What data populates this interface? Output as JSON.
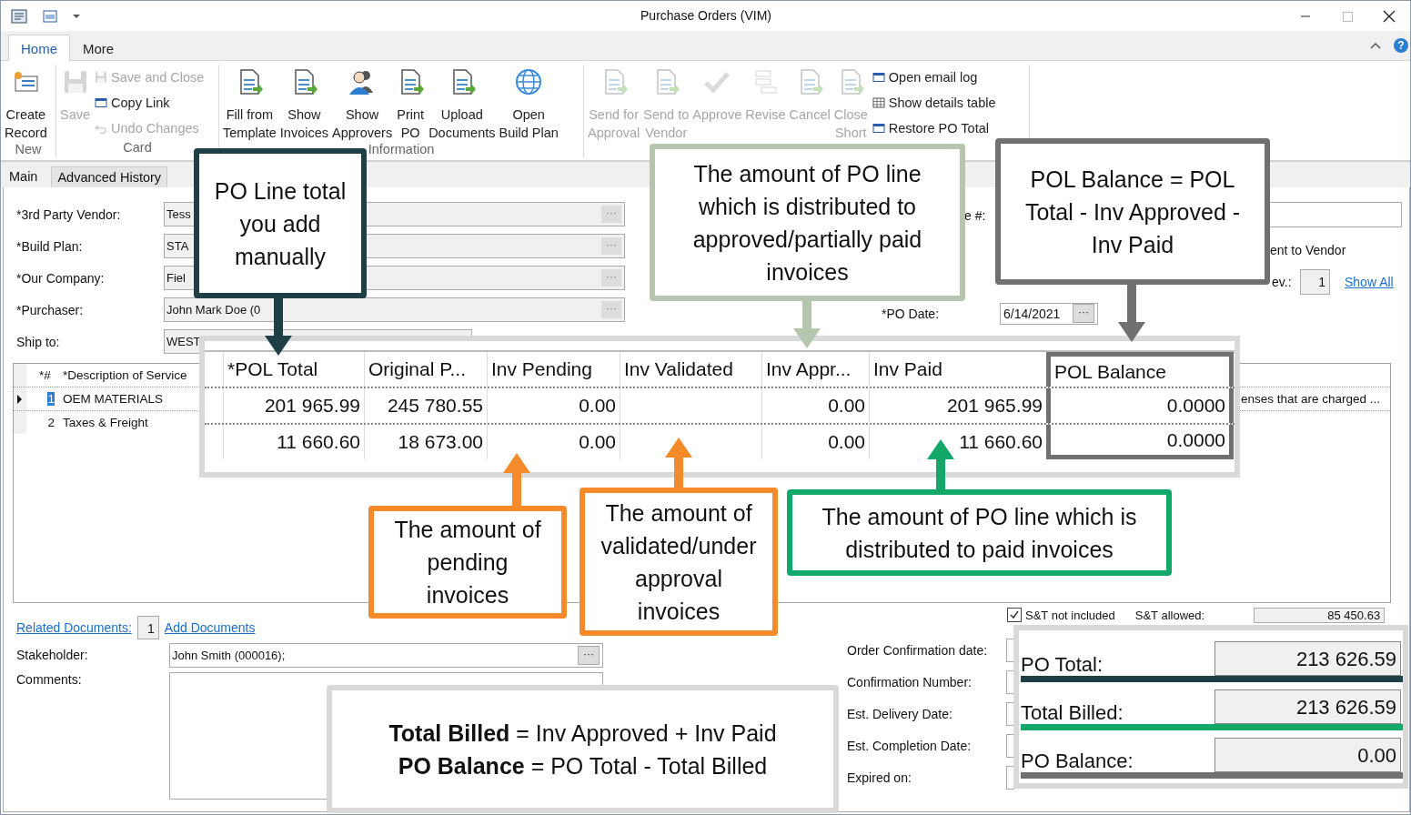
{
  "window": {
    "title": "Purchase Orders (VIM)",
    "help": "?"
  },
  "ribbon_tabs": [
    {
      "label": "Home",
      "selected": true
    },
    {
      "label": "More",
      "selected": false
    }
  ],
  "ribbon_groups": [
    {
      "label": "New",
      "buttons": [
        {
          "kind": "large",
          "lines": [
            "Create",
            "Record"
          ],
          "disabled": false
        }
      ]
    },
    {
      "label": "Card",
      "buttons": [
        {
          "kind": "large",
          "lines": [
            "Save"
          ],
          "disabled": true
        },
        {
          "kind": "small",
          "lines": [
            "Save and Close"
          ],
          "disabled": true
        },
        {
          "kind": "small",
          "lines": [
            "Copy Link"
          ],
          "disabled": false
        },
        {
          "kind": "small",
          "lines": [
            "Undo Changes"
          ],
          "disabled": true
        }
      ]
    },
    {
      "label": "Information",
      "buttons": [
        {
          "kind": "large",
          "lines": [
            "Fill from",
            "Template"
          ],
          "disabled": false
        },
        {
          "kind": "large",
          "lines": [
            "Show",
            "Invoices"
          ],
          "disabled": false
        },
        {
          "kind": "large",
          "lines": [
            "Show",
            "Approvers"
          ],
          "disabled": false
        },
        {
          "kind": "large",
          "lines": [
            "Print",
            "PO"
          ],
          "disabled": false
        },
        {
          "kind": "large",
          "lines": [
            "Upload",
            "Documents"
          ],
          "disabled": false
        },
        {
          "kind": "large",
          "lines": [
            "Open",
            "Build Plan"
          ],
          "disabled": false
        }
      ]
    },
    {
      "buttons": [
        {
          "kind": "large",
          "lines": [
            "Send for",
            "Approval"
          ],
          "disabled": true
        },
        {
          "kind": "large",
          "lines": [
            "Send to",
            "Vendor"
          ],
          "disabled": true
        },
        {
          "kind": "large",
          "lines": [
            "Approve"
          ],
          "disabled": true
        },
        {
          "kind": "large",
          "lines": [
            "Revise"
          ],
          "disabled": true
        },
        {
          "kind": "large",
          "lines": [
            "Cancel"
          ],
          "disabled": true
        },
        {
          "kind": "large",
          "lines": [
            "Close",
            "Short"
          ],
          "disabled": true
        },
        {
          "kind": "small",
          "lines": [
            "Open email log"
          ],
          "disabled": false
        },
        {
          "kind": "small",
          "lines": [
            "Show details table"
          ],
          "disabled": false
        },
        {
          "kind": "small",
          "lines": [
            "Restore PO Total"
          ],
          "disabled": false
        }
      ]
    }
  ],
  "sub_tabs": [
    {
      "label": "Main",
      "selected": true
    },
    {
      "label": "Advanced History",
      "selected": false
    }
  ],
  "left_fields": [
    {
      "label": "*3rd Party Vendor:",
      "value": "Tess",
      "button": "···"
    },
    {
      "label": "*Build Plan:",
      "value": "STA",
      "button": "···"
    },
    {
      "label": "*Our Company:",
      "value": "Fiel",
      "button": "···"
    },
    {
      "label": "*Purchaser:",
      "value": "John Mark Doe (0",
      "button": "···"
    },
    {
      "label": "Ship to:",
      "value": "WEST"
    }
  ],
  "right_top": {
    "number_label": "e #:",
    "sent_label": "ent to Vendor",
    "rev_label": "ev.:",
    "rev_value": "1",
    "show_all": "Show All",
    "po_date_label": "*PO Date:",
    "po_date": "6/14/2021",
    "po_date_button": "···"
  },
  "lines_grid": {
    "columns": [
      "*#",
      "*Description of Service"
    ],
    "rows": [
      {
        "number": "1",
        "description": "OEM MATERIALS",
        "note": "enses that are charged ...",
        "selected": true
      },
      {
        "number": "2",
        "description": "Taxes & Freight",
        "selected": false
      }
    ]
  },
  "related": {
    "label": "Related Documents:",
    "count": "1",
    "add": "Add Documents"
  },
  "stakeholder": {
    "label": "Stakeholder:",
    "value": "John Smith (000016);",
    "button": "···"
  },
  "comments": {
    "label": "Comments:"
  },
  "st": {
    "checked": true,
    "label": "S&T not included",
    "allowed_label": "S&T allowed:",
    "allowed_value": "85 450.63"
  },
  "dates": [
    {
      "label": "Order Confirmation date:"
    },
    {
      "label": "Confirmation Number:"
    },
    {
      "label": "Est. Delivery Date:"
    },
    {
      "label": "Est. Completion Date:"
    },
    {
      "label": "Expired on:"
    }
  ],
  "zoom_table": {
    "columns": [
      {
        "label": "*POL Total",
        "highlighted": false
      },
      {
        "label": "Original P...",
        "highlighted": false
      },
      {
        "label": "Inv Pending",
        "highlighted": false
      },
      {
        "label": "Inv Validated",
        "highlighted": false
      },
      {
        "label": "Inv Appr...",
        "highlighted": false
      },
      {
        "label": "Inv Paid",
        "highlighted": false
      },
      {
        "label": "POL Balance",
        "highlighted": true
      }
    ],
    "rows": [
      [
        "201 965.99",
        "245 780.55",
        "0.00",
        null,
        "0.00",
        "201 965.99",
        "0.0000"
      ],
      [
        "11 660.60",
        "18 673.00",
        "0.00",
        null,
        "0.00",
        "11 660.60",
        "0.0000"
      ]
    ]
  },
  "callouts": [
    {
      "text": "PO Line total you add manually",
      "color": "#1f3f47"
    },
    {
      "text": "The amount of PO line which is distributed to approved/partially paid invoices",
      "color": "#b5c5ae"
    },
    {
      "text": "POL Balance = POL Total - Inv Approved - Inv Paid",
      "color": "#707070"
    },
    {
      "text": "The amount of pending invoices",
      "color": "#f58a2a"
    },
    {
      "text": "The amount of validated/under approval invoices",
      "color": "#f58a2a"
    },
    {
      "text": "The amount of PO line which is distributed to paid invoices",
      "color": "#12a86a"
    }
  ],
  "formula_note": {
    "lines": [
      "**Total Billed** = Inv Approved + Inv Paid",
      "**PO Balance** = PO Total - Total Billed"
    ]
  },
  "totals": [
    {
      "label": "PO Total:",
      "value": "213 626.59",
      "color": "#1f3f47"
    },
    {
      "label": "Total Billed:",
      "value": "213 626.59",
      "color": "#12a86a"
    },
    {
      "label": "PO Balance:",
      "value": "0.00",
      "color": "#707070"
    }
  ]
}
